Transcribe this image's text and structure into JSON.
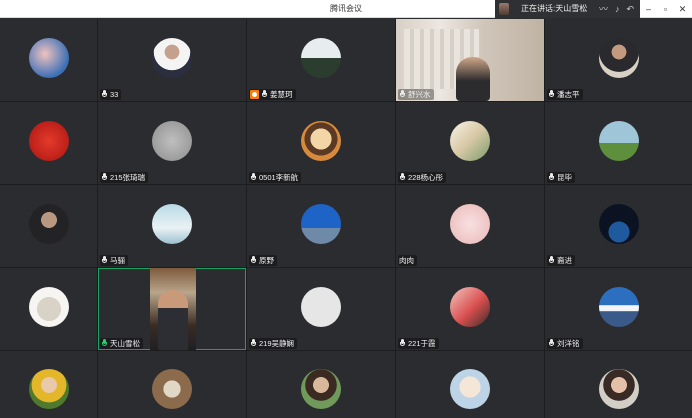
{
  "window": {
    "title": "腾讯会议",
    "speaking_label": "正在讲话:",
    "speaking_name": "天山雪松"
  },
  "tiles": [
    {
      "name": "",
      "mic": true
    },
    {
      "name": "33",
      "mic": true
    },
    {
      "name": "姜慧珂",
      "mic": true,
      "host": true
    },
    {
      "name": "舒兴水",
      "mic": true,
      "video": true
    },
    {
      "name": "潘志平",
      "mic": true
    },
    {
      "name": "",
      "mic": false
    },
    {
      "name": "215张琦瑞",
      "mic": true
    },
    {
      "name": "0501李新航",
      "mic": true
    },
    {
      "name": "228杨心彤",
      "mic": true
    },
    {
      "name": "昆毕",
      "mic": true
    },
    {
      "name": "",
      "mic": false
    },
    {
      "name": "马骊",
      "mic": true
    },
    {
      "name": "原野",
      "mic": true
    },
    {
      "name": "肉肉",
      "mic": false
    },
    {
      "name": "裔进",
      "mic": true
    },
    {
      "name": "",
      "mic": false
    },
    {
      "name": "天山雪松",
      "mic": true,
      "video": true,
      "active": true
    },
    {
      "name": "219吴静娴",
      "mic": true
    },
    {
      "name": "221于霞",
      "mic": true
    },
    {
      "name": "刘洋铭",
      "mic": true
    },
    {
      "name": "",
      "mic": false
    },
    {
      "name": "",
      "mic": false
    },
    {
      "name": "",
      "mic": false
    },
    {
      "name": "",
      "mic": false
    },
    {
      "name": "",
      "mic": false
    }
  ],
  "colors": {
    "background": "#2b2c30",
    "active_border": "#1aa260",
    "host_badge": "#ff7a00"
  }
}
